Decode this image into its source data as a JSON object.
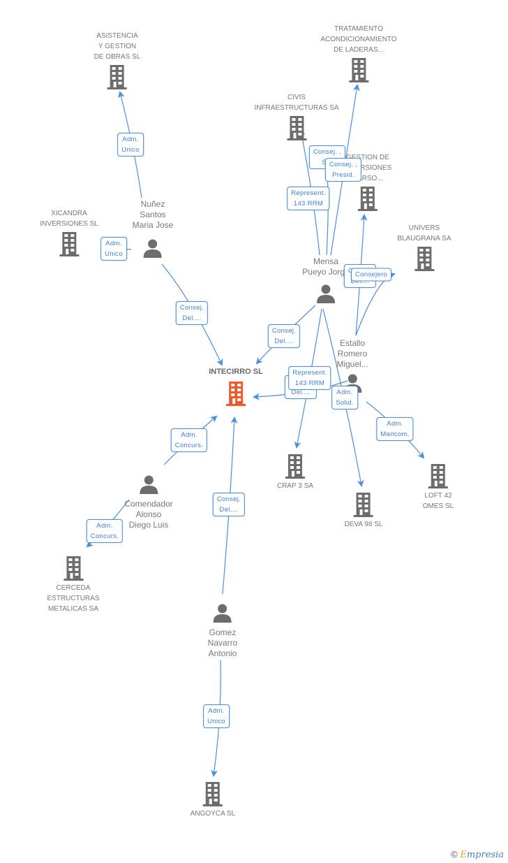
{
  "colors": {
    "edge": "#4a8ee0",
    "icon": "#6d6d6d",
    "center_icon": "#f05a2a"
  },
  "center": {
    "label": "INTECIRRO SL"
  },
  "companies": [
    {
      "id": "asistencia",
      "label": "ASISTENCIA\nY GESTION\nDE OBRAS SL"
    },
    {
      "id": "tratamiento",
      "label": "TRATAMIENTO\nACONDICIONAMIENTO\nDE LADERAS..."
    },
    {
      "id": "civis",
      "label": "CIVIS\nINFRAESTRUCTURAS SA"
    },
    {
      "id": "gestion",
      "label": "GESTION DE\nINVERSIONES\nBARSO..."
    },
    {
      "id": "xicandra",
      "label": "XICANDRA\nINVERSIONES SL"
    },
    {
      "id": "univers",
      "label": "UNIVERS\nBLAUGRANA SA"
    },
    {
      "id": "crap",
      "label": "CRAP 3 SA"
    },
    {
      "id": "deva",
      "label": "DEVA 98 SL"
    },
    {
      "id": "loft",
      "label": "LOFT 42\nOMES SL"
    },
    {
      "id": "cerceda",
      "label": "CERCEDA\nESTRUCTURAS\nMETALICAS SA"
    },
    {
      "id": "angoyca",
      "label": "ANGOYCA SL"
    }
  ],
  "people": [
    {
      "id": "nunez",
      "label": "Nuñez\nSantos\nMaria Jose"
    },
    {
      "id": "mensa",
      "label": "Mensa\nPueyo Jorge"
    },
    {
      "id": "estallo",
      "label": "Estallo\nRomero\nMiguel..."
    },
    {
      "id": "comendador",
      "label": "Comendador\nAlonso\nDiego Luis"
    },
    {
      "id": "gomez",
      "label": "Gomez\nNavarro\nAntonio"
    }
  ],
  "edges": [
    {
      "from": "nunez",
      "to": "asistencia",
      "label": "Adm.\nUnico"
    },
    {
      "from": "nunez",
      "to": "xicandra",
      "label": "Adm.\nUnico"
    },
    {
      "from": "nunez",
      "to": "center",
      "label": "Consej.\nDel...."
    },
    {
      "from": "mensa",
      "to": "civis",
      "label": "Represent.\n143 RRM"
    },
    {
      "from": "mensa",
      "to": "tratamiento",
      "label": "Consej. ,\nPresid."
    },
    {
      "from": "mensa",
      "to": "gestion",
      "label": "Consej. ,\nS..."
    },
    {
      "from": "mensa",
      "to": "center",
      "label": "Consej.\nDel...."
    },
    {
      "from": "mensa",
      "to": "crap",
      "label": "Represent.\n143 RRM"
    },
    {
      "from": "mensa",
      "to": "deva",
      "label": "Adm.\nSolid."
    },
    {
      "from": "estallo",
      "to": "gestion",
      "label": "Consej.\nDel...."
    },
    {
      "from": "estallo",
      "to": "univers",
      "label": "Consejero"
    },
    {
      "from": "estallo",
      "to": "center",
      "label": "Consej.\nDel...."
    },
    {
      "from": "estallo",
      "to": "loft",
      "label": "Adm.\nMancom."
    },
    {
      "from": "comendador",
      "to": "center",
      "label": "Adm.\nConcurs."
    },
    {
      "from": "comendador",
      "to": "cerceda",
      "label": "Adm.\nConcurs."
    },
    {
      "from": "gomez",
      "to": "center",
      "label": "Consej.\nDel...."
    },
    {
      "from": "gomez",
      "to": "angoyca",
      "label": "Adm.\nUnico"
    }
  ],
  "footer": {
    "copyright": "©",
    "brand_initial": "E",
    "brand_rest": "mpresia"
  }
}
